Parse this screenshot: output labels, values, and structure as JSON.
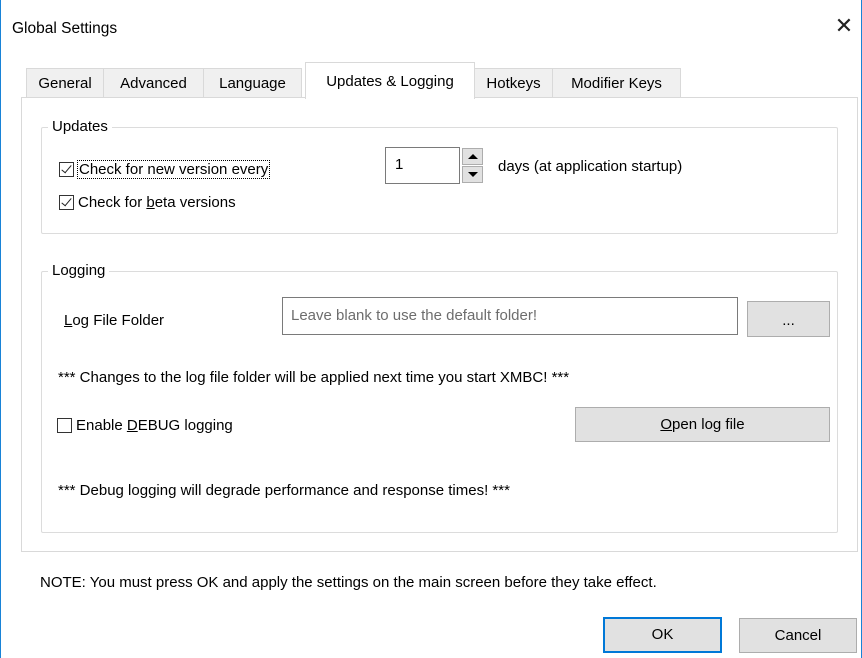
{
  "window": {
    "title": "Global Settings",
    "close_glyph": "✕"
  },
  "tabs": [
    {
      "label": "General"
    },
    {
      "label": "Advanced"
    },
    {
      "label": "Language"
    },
    {
      "label": "Updates & Logging",
      "active": true
    },
    {
      "label": "Hotkeys"
    },
    {
      "label": "Modifier Keys"
    }
  ],
  "updates": {
    "group_label": "Updates",
    "check_version": {
      "label": "Check for new version every",
      "checked": true
    },
    "interval_value": "1",
    "interval_suffix": "days (at application startup)",
    "check_beta": {
      "prefix": "Check for ",
      "underlined": "b",
      "rest": "eta versions",
      "checked": true
    }
  },
  "logging": {
    "group_label": "Logging",
    "folder_label": {
      "underlined": "L",
      "rest": "og File Folder"
    },
    "folder_placeholder": "Leave blank to use the default folder!",
    "browse_label": "...",
    "folder_note": "*** Changes to the log file folder will be applied next time you start XMBC! ***",
    "debug": {
      "prefix": "Enable ",
      "underlined": "D",
      "rest": "EBUG logging",
      "checked": false
    },
    "open_log": {
      "underlined": "O",
      "rest": "pen log file"
    },
    "debug_note": "*** Debug logging will degrade performance and response times! ***"
  },
  "footer": {
    "note": "NOTE: You must press OK and apply the settings on the main screen before they take effect.",
    "ok_label": "OK",
    "cancel_label": "Cancel"
  },
  "colors": {
    "accent": "#0078d7",
    "button_bg": "#e1e1e1",
    "border": "#dcdcdc"
  }
}
